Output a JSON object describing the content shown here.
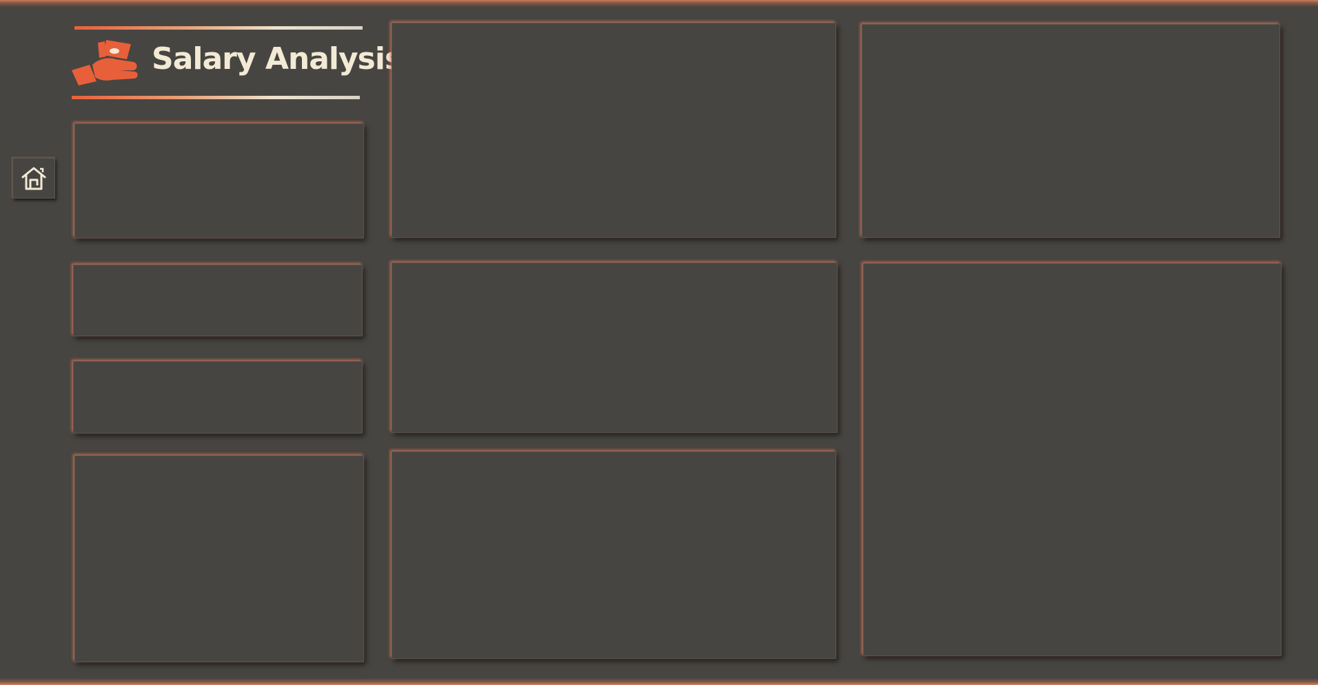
{
  "header": {
    "title": "Salary Analysis",
    "logo_icon": "salary-money-hand-icon"
  },
  "nav": {
    "home_icon": "home-icon"
  },
  "colors": {
    "background": "#474541",
    "accent": "#e8603a",
    "title_text": "#f3ead6"
  }
}
